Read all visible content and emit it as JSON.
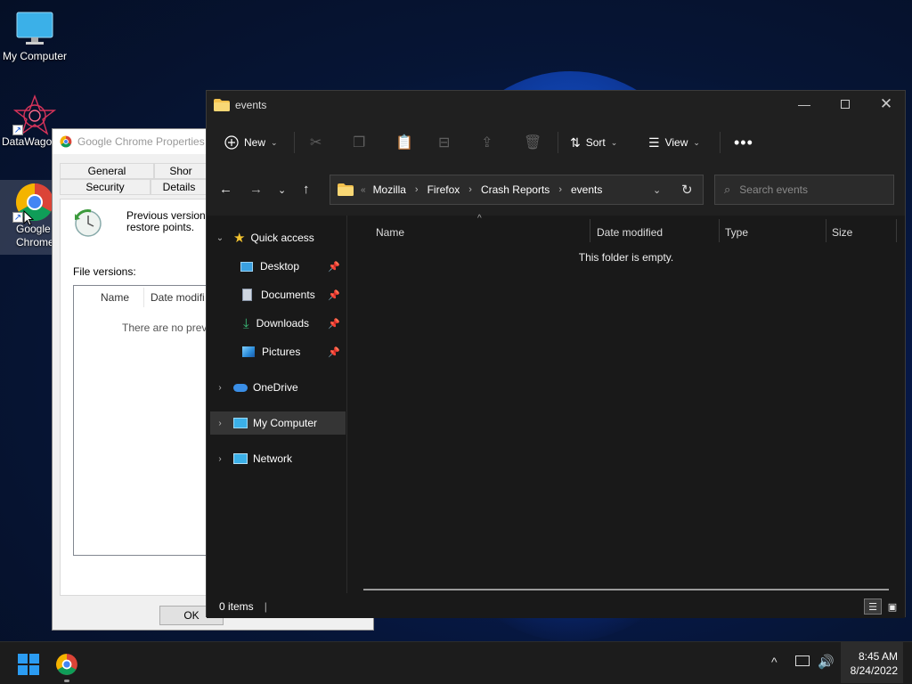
{
  "desktop": {
    "icons": [
      {
        "label": "My Computer"
      },
      {
        "label": "DataWago"
      },
      {
        "label": "Google Chrome"
      }
    ]
  },
  "properties_dialog": {
    "title": "Google Chrome Properties",
    "tabs": [
      "General",
      "Shor",
      "Security",
      "Details"
    ],
    "description": "Previous versions c restore points.",
    "description_line1": "Previous versions c",
    "description_line2": "restore points.",
    "file_versions_label": "File versions:",
    "columns": [
      "Name",
      "Date modifi"
    ],
    "empty_text": "There are no previ",
    "ok_label": "OK"
  },
  "explorer": {
    "title": "events",
    "toolbar": {
      "new_label": "New",
      "sort_label": "Sort",
      "view_label": "View"
    },
    "address": {
      "crumbs": [
        "Mozilla",
        "Firefox",
        "Crash Reports",
        "events"
      ]
    },
    "search": {
      "placeholder": "Search events"
    },
    "sidebar": {
      "quick_access": "Quick access",
      "desktop": "Desktop",
      "documents": "Documents",
      "downloads": "Downloads",
      "pictures": "Pictures",
      "onedrive": "OneDrive",
      "my_computer": "My Computer",
      "network": "Network"
    },
    "columns": {
      "name": "Name",
      "date_modified": "Date modified",
      "type": "Type",
      "size": "Size"
    },
    "empty_message": "This folder is empty.",
    "status": "0 items"
  },
  "taskbar": {
    "time": "8:45 AM",
    "date": "8/24/2022"
  }
}
